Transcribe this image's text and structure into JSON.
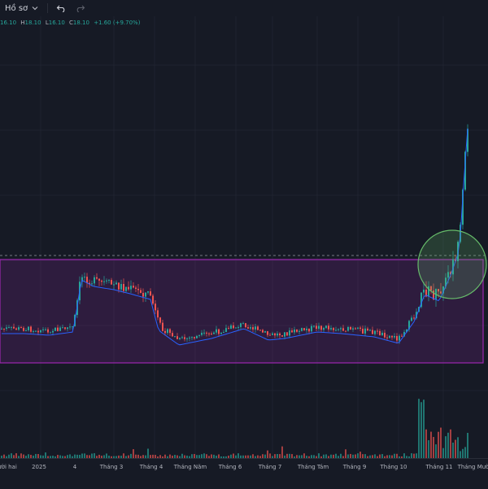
{
  "toolbar": {
    "profile_label": "Hồ sơ",
    "profile_chevron_icon": "chevron-down-icon",
    "undo_icon": "undo-icon",
    "redo_icon": "redo-icon"
  },
  "ohlc": {
    "o_label": "",
    "o_value": "16.10",
    "h_label": "H",
    "h_value": "18.10",
    "l_label": "L",
    "l_value": "16.10",
    "c_label": "C",
    "c_value": "18.10",
    "change": "+1.60 (+9.70%)"
  },
  "xaxis_labels": [
    "ười hai",
    "2025",
    "4",
    "Tháng 3",
    "Tháng 4",
    "Tháng Năm",
    "Tháng 6",
    "Tháng 7",
    "Tháng Tám",
    "Tháng 9",
    "Tháng 10",
    "Tháng 11",
    "Tháng Mười"
  ],
  "colors": {
    "up": "#26a69a",
    "down": "#ef5350",
    "ma": "#2962ff",
    "box": "#9c27b0",
    "highlight": "#66bb6a",
    "background": "#161a25"
  }
}
